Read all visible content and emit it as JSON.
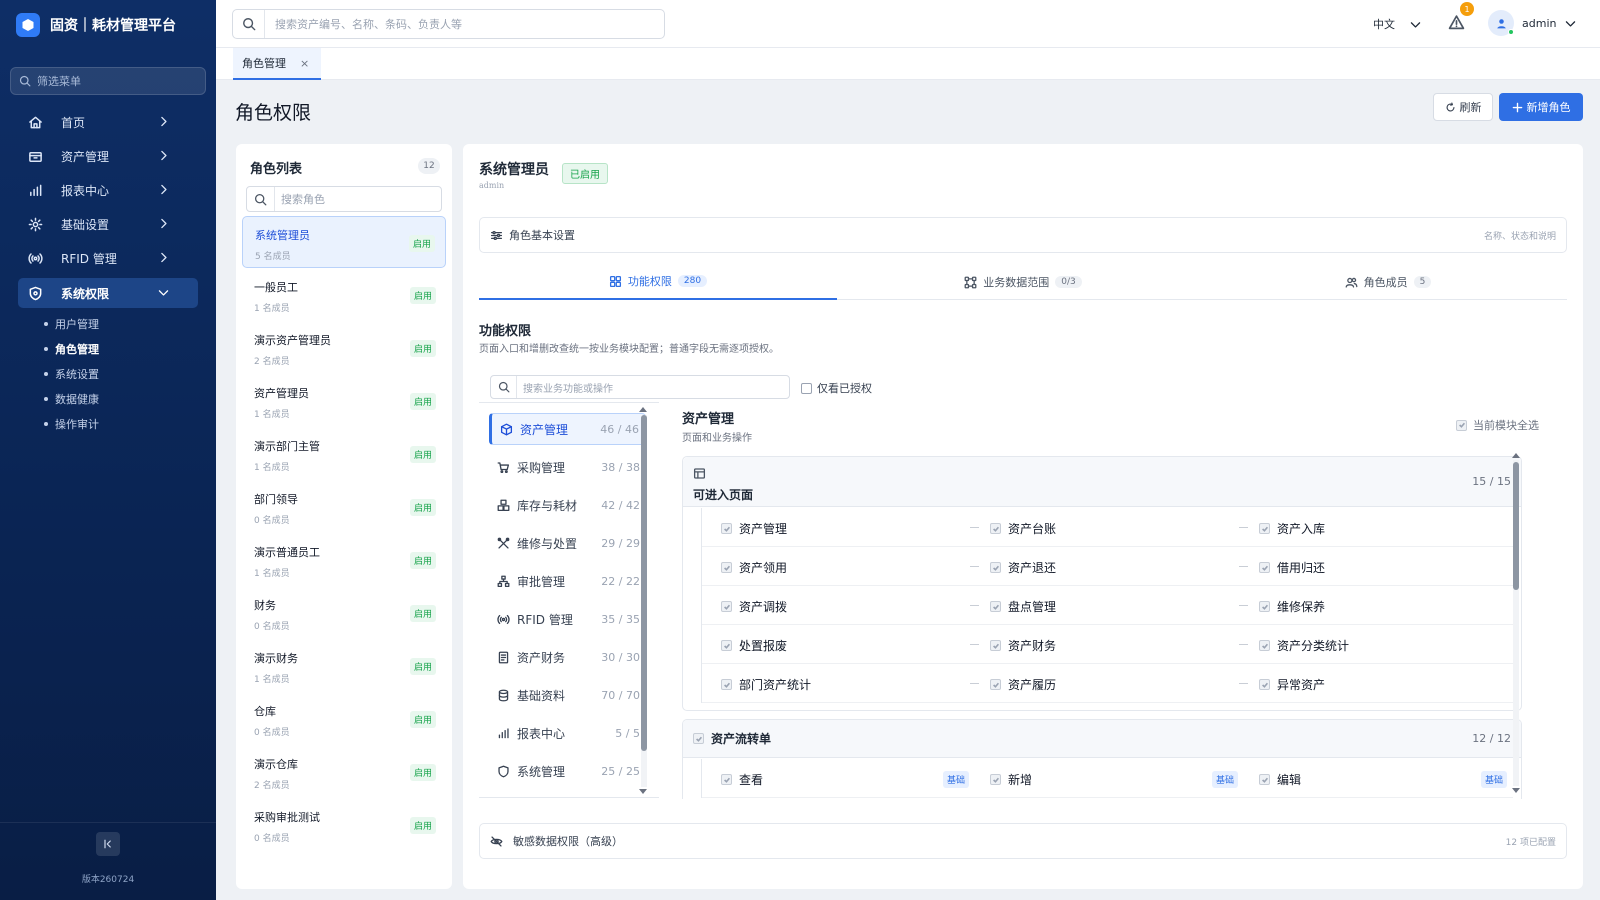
{
  "app": {
    "title": "固资｜耗材管理平台",
    "version": "版本260724"
  },
  "sidebar": {
    "filter_placeholder": "筛选菜单",
    "items": [
      {
        "label": "首页",
        "icon": "home-icon"
      },
      {
        "label": "资产管理",
        "icon": "box-icon"
      },
      {
        "label": "报表中心",
        "icon": "bar-chart-icon"
      },
      {
        "label": "基础设置",
        "icon": "gear-icon"
      },
      {
        "label": "RFID 管理",
        "icon": "rfid-icon"
      },
      {
        "label": "系统权限",
        "icon": "shield-icon",
        "active": true
      }
    ],
    "subitems": [
      "用户管理",
      "角色管理",
      "系统设置",
      "数据健康",
      "操作审计"
    ],
    "active_subitem": "角色管理"
  },
  "header": {
    "search_placeholder": "搜索资产编号、名称、条码、负责人等",
    "language": "中文",
    "alert_count": "1",
    "user": "admin"
  },
  "tabs": [
    {
      "label": "角色管理",
      "close": "×"
    }
  ],
  "page": {
    "title": "角色权限",
    "refresh_label": "刷新",
    "add_label": "新增角色"
  },
  "roles": {
    "title": "角色列表",
    "count": "12",
    "search_placeholder": "搜索角色",
    "items": [
      {
        "name": "系统管理员",
        "members": "5 名成员",
        "status": "启用"
      },
      {
        "name": "一般员工",
        "members": "1 名成员",
        "status": "启用"
      },
      {
        "name": "演示资产管理员",
        "members": "2 名成员",
        "status": "启用"
      },
      {
        "name": "资产管理员",
        "members": "1 名成员",
        "status": "启用"
      },
      {
        "name": "演示部门主管",
        "members": "1 名成员",
        "status": "启用"
      },
      {
        "name": "部门领导",
        "members": "0 名成员",
        "status": "启用"
      },
      {
        "name": "演示普通员工",
        "members": "1 名成员",
        "status": "启用"
      },
      {
        "name": "财务",
        "members": "0 名成员",
        "status": "启用"
      },
      {
        "name": "演示财务",
        "members": "1 名成员",
        "status": "启用"
      },
      {
        "name": "仓库",
        "members": "0 名成员",
        "status": "启用"
      },
      {
        "name": "演示仓库",
        "members": "2 名成员",
        "status": "启用"
      },
      {
        "name": "采购审批测试",
        "members": "0 名成员",
        "status": "启用"
      }
    ]
  },
  "detail": {
    "role_name": "系统管理员",
    "role_code": "admin",
    "status": "已启用",
    "basic_settings": {
      "label": "角色基本设置",
      "hint": "名称、状态和说明"
    },
    "tabs": [
      {
        "label": "功能权限",
        "count": "280",
        "icon": "grid-icon"
      },
      {
        "label": "业务数据范围",
        "count": "0/3",
        "icon": "scope-icon"
      },
      {
        "label": "角色成员",
        "count": "5",
        "icon": "users-icon"
      }
    ],
    "section_title": "功能权限",
    "section_desc": "页面入口和增删改查统一按业务模块配置；普通字段无需逐项授权。",
    "fn_search_placeholder": "搜索业务功能或操作",
    "only_authorized": "仅看已授权",
    "modules": [
      {
        "name": "资产管理",
        "count": "46 / 46",
        "icon": "cube-icon"
      },
      {
        "name": "采购管理",
        "count": "38 / 38",
        "icon": "cart-icon"
      },
      {
        "name": "库存与耗材",
        "count": "42 / 42",
        "icon": "boxes-icon"
      },
      {
        "name": "维修与处置",
        "count": "29 / 29",
        "icon": "tools-icon"
      },
      {
        "name": "审批管理",
        "count": "22 / 22",
        "icon": "tree-icon"
      },
      {
        "name": "RFID 管理",
        "count": "35 / 35",
        "icon": "rfid-icon"
      },
      {
        "name": "资产财务",
        "count": "30 / 30",
        "icon": "ledger-icon"
      },
      {
        "name": "基础资料",
        "count": "70 / 70",
        "icon": "database-icon"
      },
      {
        "name": "报表中心",
        "count": "5 / 5",
        "icon": "bar-chart-icon"
      },
      {
        "name": "系统管理",
        "count": "25 / 25",
        "icon": "shield-icon"
      }
    ],
    "module_title": "资产管理",
    "module_sub": "页面和业务操作",
    "select_all": "当前模块全选",
    "group1": {
      "title": "可进入页面",
      "count": "15 / 15",
      "rows": [
        [
          "资产管理",
          "资产台账",
          "资产入库"
        ],
        [
          "资产领用",
          "资产退还",
          "借用归还"
        ],
        [
          "资产调拨",
          "盘点管理",
          "维修保养"
        ],
        [
          "处置报废",
          "资产财务",
          "资产分类统计"
        ],
        [
          "部门资产统计",
          "资产履历",
          "异常资产"
        ]
      ]
    },
    "group2": {
      "title": "资产流转单",
      "count": "12 / 12",
      "ops": [
        {
          "label": "查看",
          "tag": "基础"
        },
        {
          "label": "新增",
          "tag": "基础"
        },
        {
          "label": "编辑",
          "tag": "基础"
        }
      ]
    },
    "sensitive": {
      "label": "敏感数据权限（高级）",
      "hint": "12 项已配置"
    }
  }
}
